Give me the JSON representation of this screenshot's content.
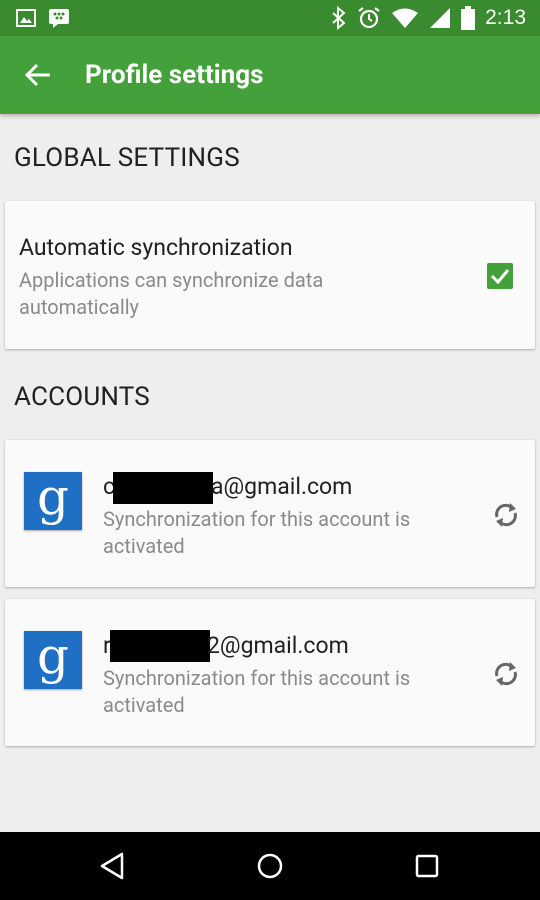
{
  "status_bar": {
    "time": "2:13",
    "left_icons": [
      "image-icon",
      "bbm-icon"
    ],
    "right_icons": [
      "bluetooth-icon",
      "alarm-icon",
      "wifi-icon",
      "signal-icon",
      "battery-icon"
    ]
  },
  "app_bar": {
    "title": "Profile settings",
    "back_icon": "arrow-back-icon"
  },
  "sections": {
    "global_header": "GLOBAL SETTINGS",
    "accounts_header": "ACCOUNTS"
  },
  "auto_sync": {
    "title": "Automatic synchronization",
    "subtitle_line1": "Applications can synchronize data",
    "subtitle_line2": "automatically",
    "checked": true
  },
  "accounts": [
    {
      "email_prefix": "c",
      "email_suffix": "a@gmail.com",
      "status_line1": "Synchronization for this account is",
      "status_line2": "activated",
      "icon": "sync-icon"
    },
    {
      "email_prefix": "r",
      "email_suffix": "2@gmail.com",
      "status_line1": "Synchronization for this account is",
      "status_line2": "activated",
      "icon": "sync-icon"
    }
  ],
  "avatar_glyph": "g",
  "nav_bar": {
    "back": "back-triangle-icon",
    "home": "home-circle-icon",
    "recents": "recents-square-icon"
  },
  "colors": {
    "status_bar": "#3a8a2f",
    "app_bar": "#43a03b",
    "accent": "#43a03b",
    "google_blue": "#1f6fc5",
    "background": "#eeeeee"
  }
}
